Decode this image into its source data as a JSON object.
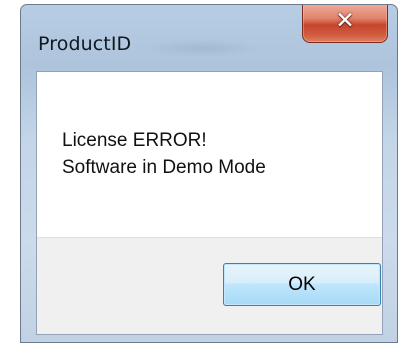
{
  "window": {
    "title": "ProductID",
    "close_glyph": "✕"
  },
  "message": {
    "line1": "License ERROR!",
    "line2": "Software in Demo Mode"
  },
  "buttons": {
    "ok_label": "OK"
  }
}
